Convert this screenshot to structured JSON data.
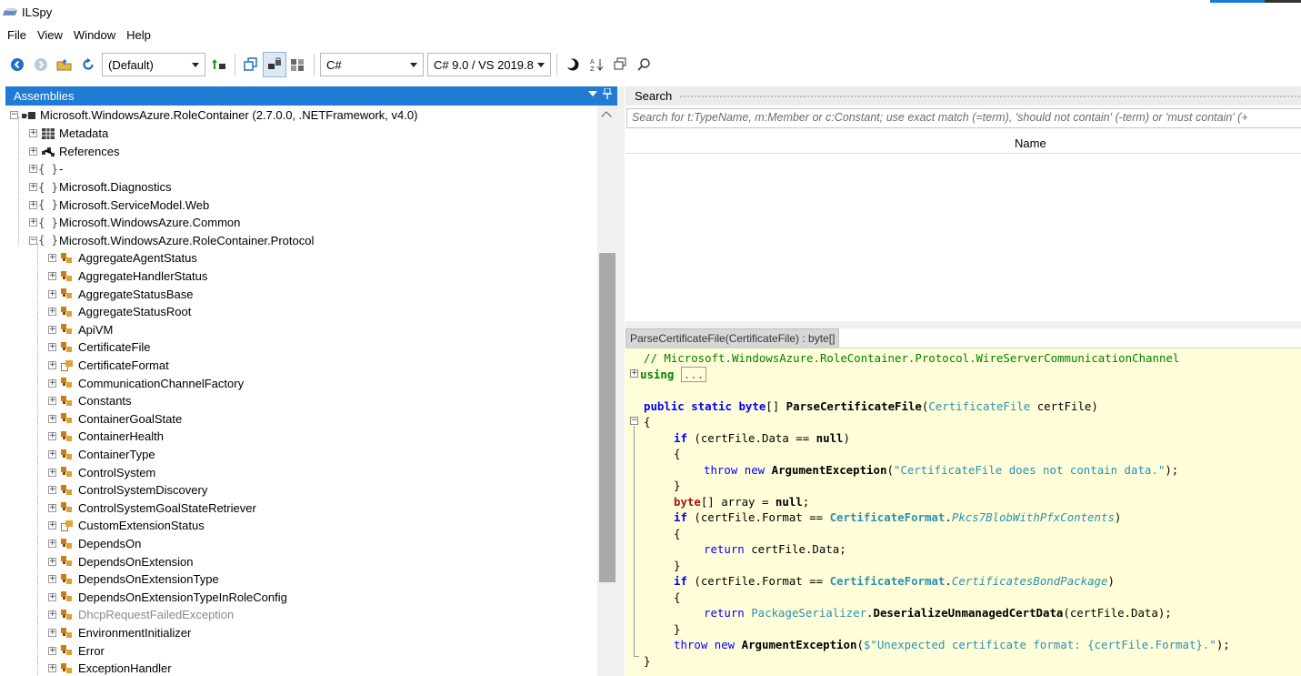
{
  "window": {
    "title": "ILSpy"
  },
  "menu": [
    "File",
    "View",
    "Window",
    "Help"
  ],
  "toolbar": {
    "assembly_list": "(Default)",
    "language": "C#",
    "language_version": "C# 9.0 / VS 2019.8"
  },
  "assemblies": {
    "header": "Assemblies",
    "root": "Microsoft.WindowsAzure.RoleContainer (2.7.0.0, .NETFramework, v4.0)",
    "top_nodes": [
      {
        "label": "Metadata",
        "icon": "metadata-icon"
      },
      {
        "label": "References",
        "icon": "references-icon"
      },
      {
        "label": "-",
        "icon": "namespace-icon"
      },
      {
        "label": "Microsoft.Diagnostics",
        "icon": "namespace-icon"
      },
      {
        "label": "Microsoft.ServiceModel.Web",
        "icon": "namespace-icon"
      },
      {
        "label": "Microsoft.WindowsAzure.Common",
        "icon": "namespace-icon"
      },
      {
        "label": "Microsoft.WindowsAzure.RoleContainer.Protocol",
        "icon": "namespace-icon"
      }
    ],
    "types": [
      {
        "label": "AggregateAgentStatus",
        "kind": "class"
      },
      {
        "label": "AggregateHandlerStatus",
        "kind": "class"
      },
      {
        "label": "AggregateStatusBase",
        "kind": "class"
      },
      {
        "label": "AggregateStatusRoot",
        "kind": "class"
      },
      {
        "label": "ApiVM",
        "kind": "class"
      },
      {
        "label": "CertificateFile",
        "kind": "class"
      },
      {
        "label": "CertificateFormat",
        "kind": "enum"
      },
      {
        "label": "CommunicationChannelFactory",
        "kind": "class"
      },
      {
        "label": "Constants",
        "kind": "class"
      },
      {
        "label": "ContainerGoalState",
        "kind": "class"
      },
      {
        "label": "ContainerHealth",
        "kind": "class"
      },
      {
        "label": "ContainerType",
        "kind": "class"
      },
      {
        "label": "ControlSystem",
        "kind": "class"
      },
      {
        "label": "ControlSystemDiscovery",
        "kind": "class"
      },
      {
        "label": "ControlSystemGoalStateRetriever",
        "kind": "class"
      },
      {
        "label": "CustomExtensionStatus",
        "kind": "enum"
      },
      {
        "label": "DependsOn",
        "kind": "class"
      },
      {
        "label": "DependsOnExtension",
        "kind": "class"
      },
      {
        "label": "DependsOnExtensionType",
        "kind": "class"
      },
      {
        "label": "DependsOnExtensionTypeInRoleConfig",
        "kind": "class"
      },
      {
        "label": "DhcpRequestFailedException",
        "kind": "class",
        "gray": true
      },
      {
        "label": "EnvironmentInitializer",
        "kind": "class"
      },
      {
        "label": "Error",
        "kind": "class"
      },
      {
        "label": "ExceptionHandler",
        "kind": "class"
      }
    ]
  },
  "search": {
    "header": "Search",
    "placeholder": "Search for t:TypeName, m:Member or c:Constant; use exact match (=term), 'should not contain' (-term) or 'must contain' (+",
    "column_name": "Name"
  },
  "code": {
    "tab_title": "ParseCertificateFile(CertificateFile) : byte[]",
    "comment": "// Microsoft.WindowsAzure.RoleContainer.Protocol.WireServerCommunicationChannel",
    "using_kw": "using",
    "using_collapsed": "...",
    "sig_kw": "public static ",
    "sig_ret": "byte",
    "sig_arr": "[] ",
    "sig_method": "ParseCertificateFile",
    "sig_p1": "(",
    "sig_ptype": "CertificateFile",
    "sig_p2": " certFile)",
    "open_brace": "{",
    "l1_kw": "if",
    "l1_text": " (certFile.Data == ",
    "l1_null": "null",
    "l1_close": ")",
    "l2": "{",
    "l3_kw": "throw new ",
    "l3_type": "ArgumentException",
    "l3_p": "(",
    "l3_str": "\"CertificateFile does not contain data.\"",
    "l3_end": ");",
    "l4": "}",
    "l5_kw": "byte",
    "l5_text": "[] array = ",
    "l5_null": "null",
    "l5_end": ";",
    "l6_kw": "if",
    "l6_text": " (certFile.Format == ",
    "l6_type": "CertificateFormat",
    "l6_dot": ".",
    "l6_member": "Pkcs7BlobWithPfxContents",
    "l6_end": ")",
    "l7": "{",
    "l8_kw": "return",
    "l8_text": " certFile.Data;",
    "l9": "}",
    "l10_kw": "if",
    "l10_text": " (certFile.Format == ",
    "l10_type": "CertificateFormat",
    "l10_dot": ".",
    "l10_member": "CertificatesBondPackage",
    "l10_end": ")",
    "l11": "{",
    "l12_kw": "return ",
    "l12_type": "PackageSerializer",
    "l12_dot": ".",
    "l12_method": "DeserializeUnmanagedCertData",
    "l12_text": "(certFile.Data);",
    "l13": "}",
    "l14_kw": "throw new ",
    "l14_type": "ArgumentException",
    "l14_p": "(",
    "l14_str": "$\"Unexpected certificate format: {certFile.Format}.\"",
    "l14_end": ");",
    "close_brace": "}"
  },
  "colors": {
    "accent": "#1f7bd3",
    "code_background": "#fffed9",
    "keyword": "#0000ff",
    "type": "#2b91af",
    "string": "#a31515",
    "comment": "#008000"
  }
}
